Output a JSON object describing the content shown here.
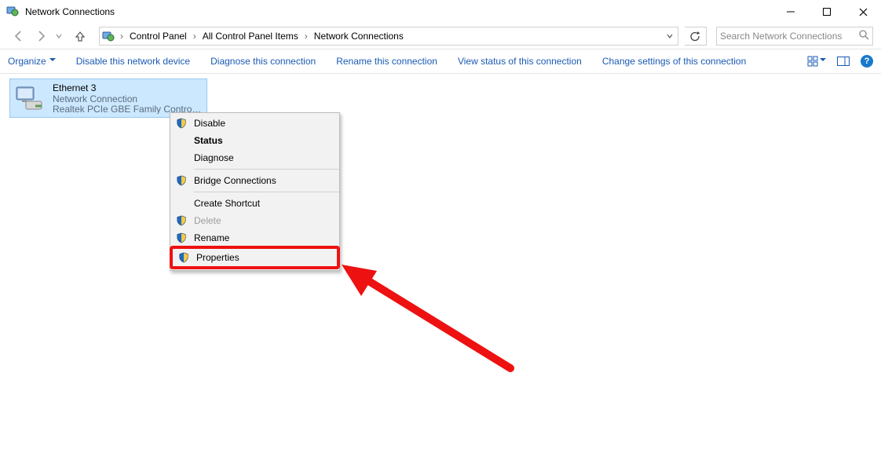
{
  "window": {
    "title": "Network Connections"
  },
  "breadcrumbs": {
    "a": "Control Panel",
    "b": "All Control Panel Items",
    "c": "Network Connections"
  },
  "search": {
    "placeholder": "Search Network Connections"
  },
  "cmdbar": {
    "organize": "Organize",
    "disable": "Disable this network device",
    "diagnose": "Diagnose this connection",
    "rename": "Rename this connection",
    "viewstatus": "View status of this connection",
    "changeset": "Change settings of this connection"
  },
  "adapter": {
    "name": "Ethernet 3",
    "status": "Network Connection",
    "device": "Realtek PCIe GBE Family Controll..."
  },
  "context_menu": {
    "disable": "Disable",
    "status": "Status",
    "diagnose": "Diagnose",
    "bridge": "Bridge Connections",
    "shortcut": "Create Shortcut",
    "delete": "Delete",
    "rename": "Rename",
    "properties": "Properties"
  },
  "symbols": {
    "help": "?"
  }
}
